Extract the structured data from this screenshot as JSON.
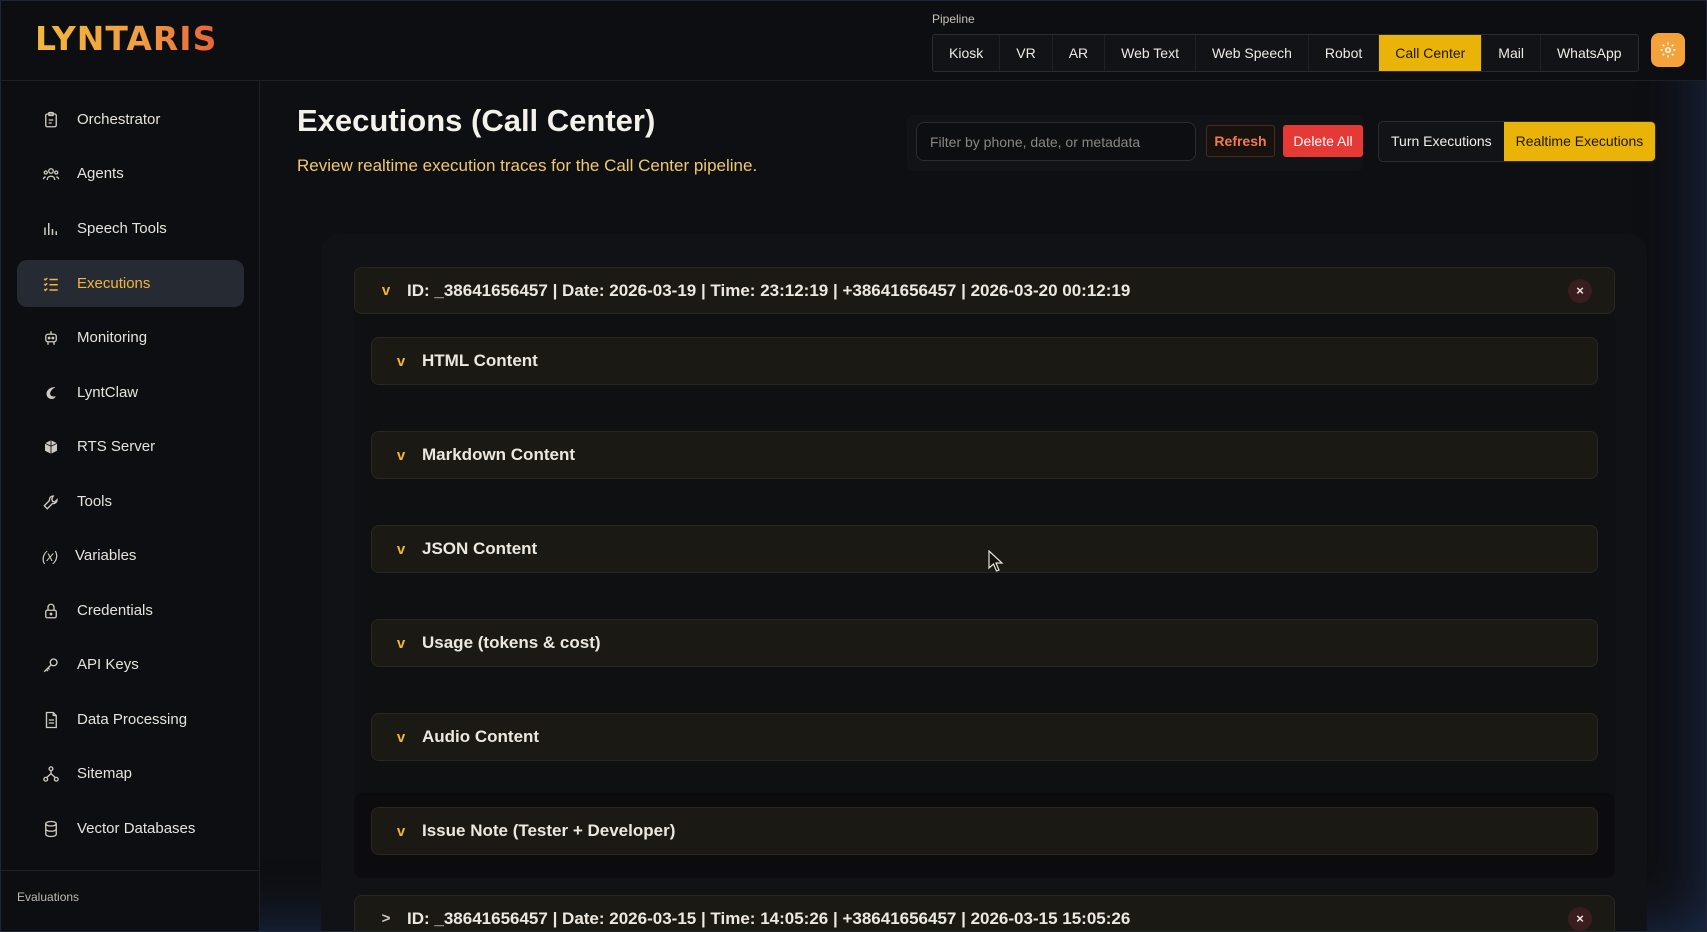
{
  "app": {
    "logo_text": "LYNTARIS"
  },
  "pipeline": {
    "label": "Pipeline",
    "tabs": [
      {
        "label": "Kiosk",
        "active": false
      },
      {
        "label": "VR",
        "active": false
      },
      {
        "label": "AR",
        "active": false
      },
      {
        "label": "Web Text",
        "active": false
      },
      {
        "label": "Web Speech",
        "active": false
      },
      {
        "label": "Robot",
        "active": false
      },
      {
        "label": "Call Center",
        "active": true
      },
      {
        "label": "Mail",
        "active": false
      },
      {
        "label": "WhatsApp",
        "active": false
      }
    ],
    "settings_icon": "gear-icon"
  },
  "sidebar": {
    "items": [
      {
        "label": "Orchestrator",
        "icon": "clipboard-icon",
        "active": false
      },
      {
        "label": "Agents",
        "icon": "users-icon",
        "active": false
      },
      {
        "label": "Speech Tools",
        "icon": "bar-chart-icon",
        "active": false
      },
      {
        "label": "Executions",
        "icon": "list-check-icon",
        "active": true
      },
      {
        "label": "Monitoring",
        "icon": "robot-icon",
        "active": false
      },
      {
        "label": "LyntClaw",
        "icon": "claw-icon",
        "active": false
      },
      {
        "label": "RTS Server",
        "icon": "server-icon",
        "active": false
      },
      {
        "label": "Tools",
        "icon": "wrench-icon",
        "active": false
      },
      {
        "label": "Variables",
        "icon": "variable-icon",
        "active": false
      },
      {
        "label": "Credentials",
        "icon": "lock-icon",
        "active": false
      },
      {
        "label": "API Keys",
        "icon": "key-icon",
        "active": false
      },
      {
        "label": "Data Processing",
        "icon": "document-icon",
        "active": false
      },
      {
        "label": "Sitemap",
        "icon": "sitemap-icon",
        "active": false
      },
      {
        "label": "Vector Databases",
        "icon": "database-icon",
        "active": false
      }
    ],
    "section_label": "Evaluations",
    "variables_glyph": "(x)"
  },
  "main": {
    "title": "Executions (Call Center)",
    "subtitle": "Review realtime execution traces for the Call Center pipeline.",
    "filter_placeholder": "Filter by phone, date, or metadata",
    "refresh_label": "Refresh",
    "delete_all_label": "Delete All",
    "mode_tabs": [
      {
        "label": "Turn Executions",
        "active": false
      },
      {
        "label": "Realtime Executions",
        "active": true
      }
    ],
    "executions": [
      {
        "title": "ID: _38641656457 | Date: 2026-03-19 | Time: 23:12:19 | +38641656457 | 2026-03-20 00:12:19",
        "expanded": true,
        "chevron": "v",
        "sections": [
          {
            "title": "HTML Content",
            "chevron": "v"
          },
          {
            "title": "Markdown Content",
            "chevron": "v"
          },
          {
            "title": "JSON Content",
            "chevron": "v"
          },
          {
            "title": "Usage (tokens & cost)",
            "chevron": "v"
          },
          {
            "title": "Audio Content",
            "chevron": "v"
          },
          {
            "title": "Issue Note (Tester + Developer)",
            "chevron": "v"
          }
        ]
      },
      {
        "title": "ID: _38641656457 | Date: 2026-03-15 | Time: 14:05:26 | +38641656457 | 2026-03-15 15:05:26",
        "expanded": false,
        "chevron": ">"
      }
    ],
    "close_glyph": "×"
  },
  "colors": {
    "accent": "#eab308",
    "active_text": "#f3b53c",
    "danger": "#e53935",
    "subtitle": "#f1c86b"
  }
}
